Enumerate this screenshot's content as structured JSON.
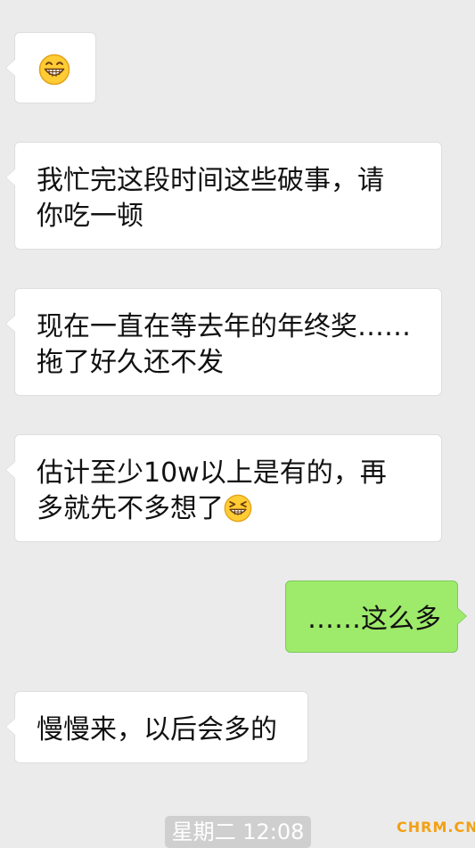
{
  "messages": [
    {
      "sender": "other",
      "lines": [],
      "emoji": "grinning-face-icon"
    },
    {
      "sender": "other",
      "lines": [
        "我忙完这段时间这些破事，请",
        "你吃一顿"
      ]
    },
    {
      "sender": "other",
      "lines": [
        "现在一直在等去年的年终奖……",
        "拖了好久还不发"
      ]
    },
    {
      "sender": "other",
      "lines": [
        "估计至少10w以上是有的，再",
        "多就先不多想了"
      ],
      "emoji": "squinting-grin-face-icon"
    },
    {
      "sender": "me",
      "lines": [
        "……这么多"
      ]
    },
    {
      "sender": "other",
      "lines": [
        "慢慢来，以后会多的"
      ]
    }
  ],
  "timestamp": "星期二 12:08",
  "watermark": "CHRM.CN",
  "colors": {
    "background": "#ebebeb",
    "incoming_bubble": "#ffffff",
    "outgoing_bubble": "#9eea6a",
    "timestamp_pill": "#cfcfcf",
    "watermark": "#f3a012"
  }
}
